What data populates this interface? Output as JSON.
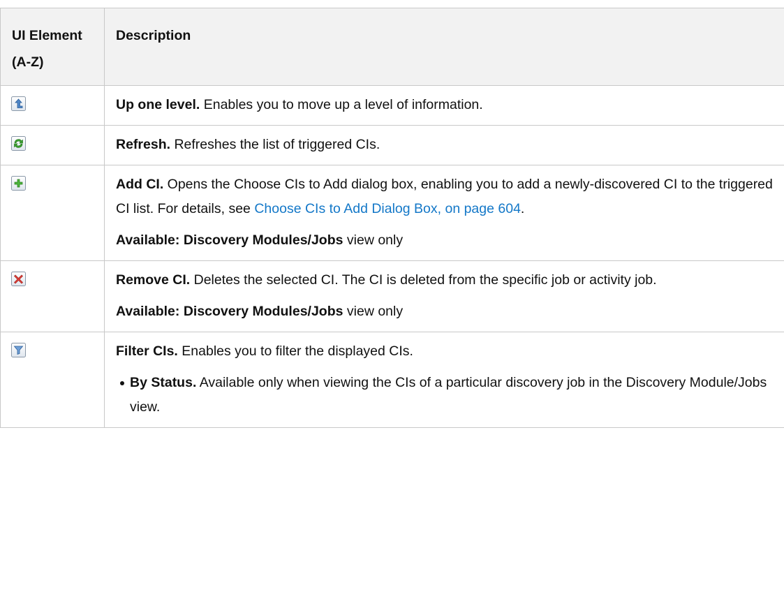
{
  "table": {
    "header": {
      "ui_element": "UI Element (A-Z)",
      "description": "Description"
    },
    "rows": [
      {
        "icon": "up-one-level-icon",
        "lead": "Up one level.",
        "text": " Enables you to move up a level of information."
      },
      {
        "icon": "refresh-icon",
        "lead": "Refresh.",
        "text": " Refreshes the list of triggered CIs."
      },
      {
        "icon": "add-icon",
        "lead": "Add CI.",
        "text": " Opens the Choose CIs to Add dialog box, enabling you to add a newly-discovered CI to the triggered CI list. For details, see ",
        "link": "Choose CIs to Add Dialog Box, on page 604",
        "text_after": ".",
        "available_bold": "Available: Discovery Modules/Jobs",
        "available_rest": " view only"
      },
      {
        "icon": "remove-icon",
        "lead": "Remove CI.",
        "text": " Deletes the selected CI. The CI is deleted from the specific job or activity job.",
        "available_bold": "Available: Discovery Modules/Jobs",
        "available_rest": " view only"
      },
      {
        "icon": "filter-icon",
        "lead": "Filter CIs.",
        "text": " Enables you to filter the displayed CIs.",
        "bullets": [
          {
            "bold": "By Status.",
            "text": " Available only when viewing the CIs of a particular discovery job in the Discovery Module/Jobs view."
          }
        ]
      }
    ]
  }
}
